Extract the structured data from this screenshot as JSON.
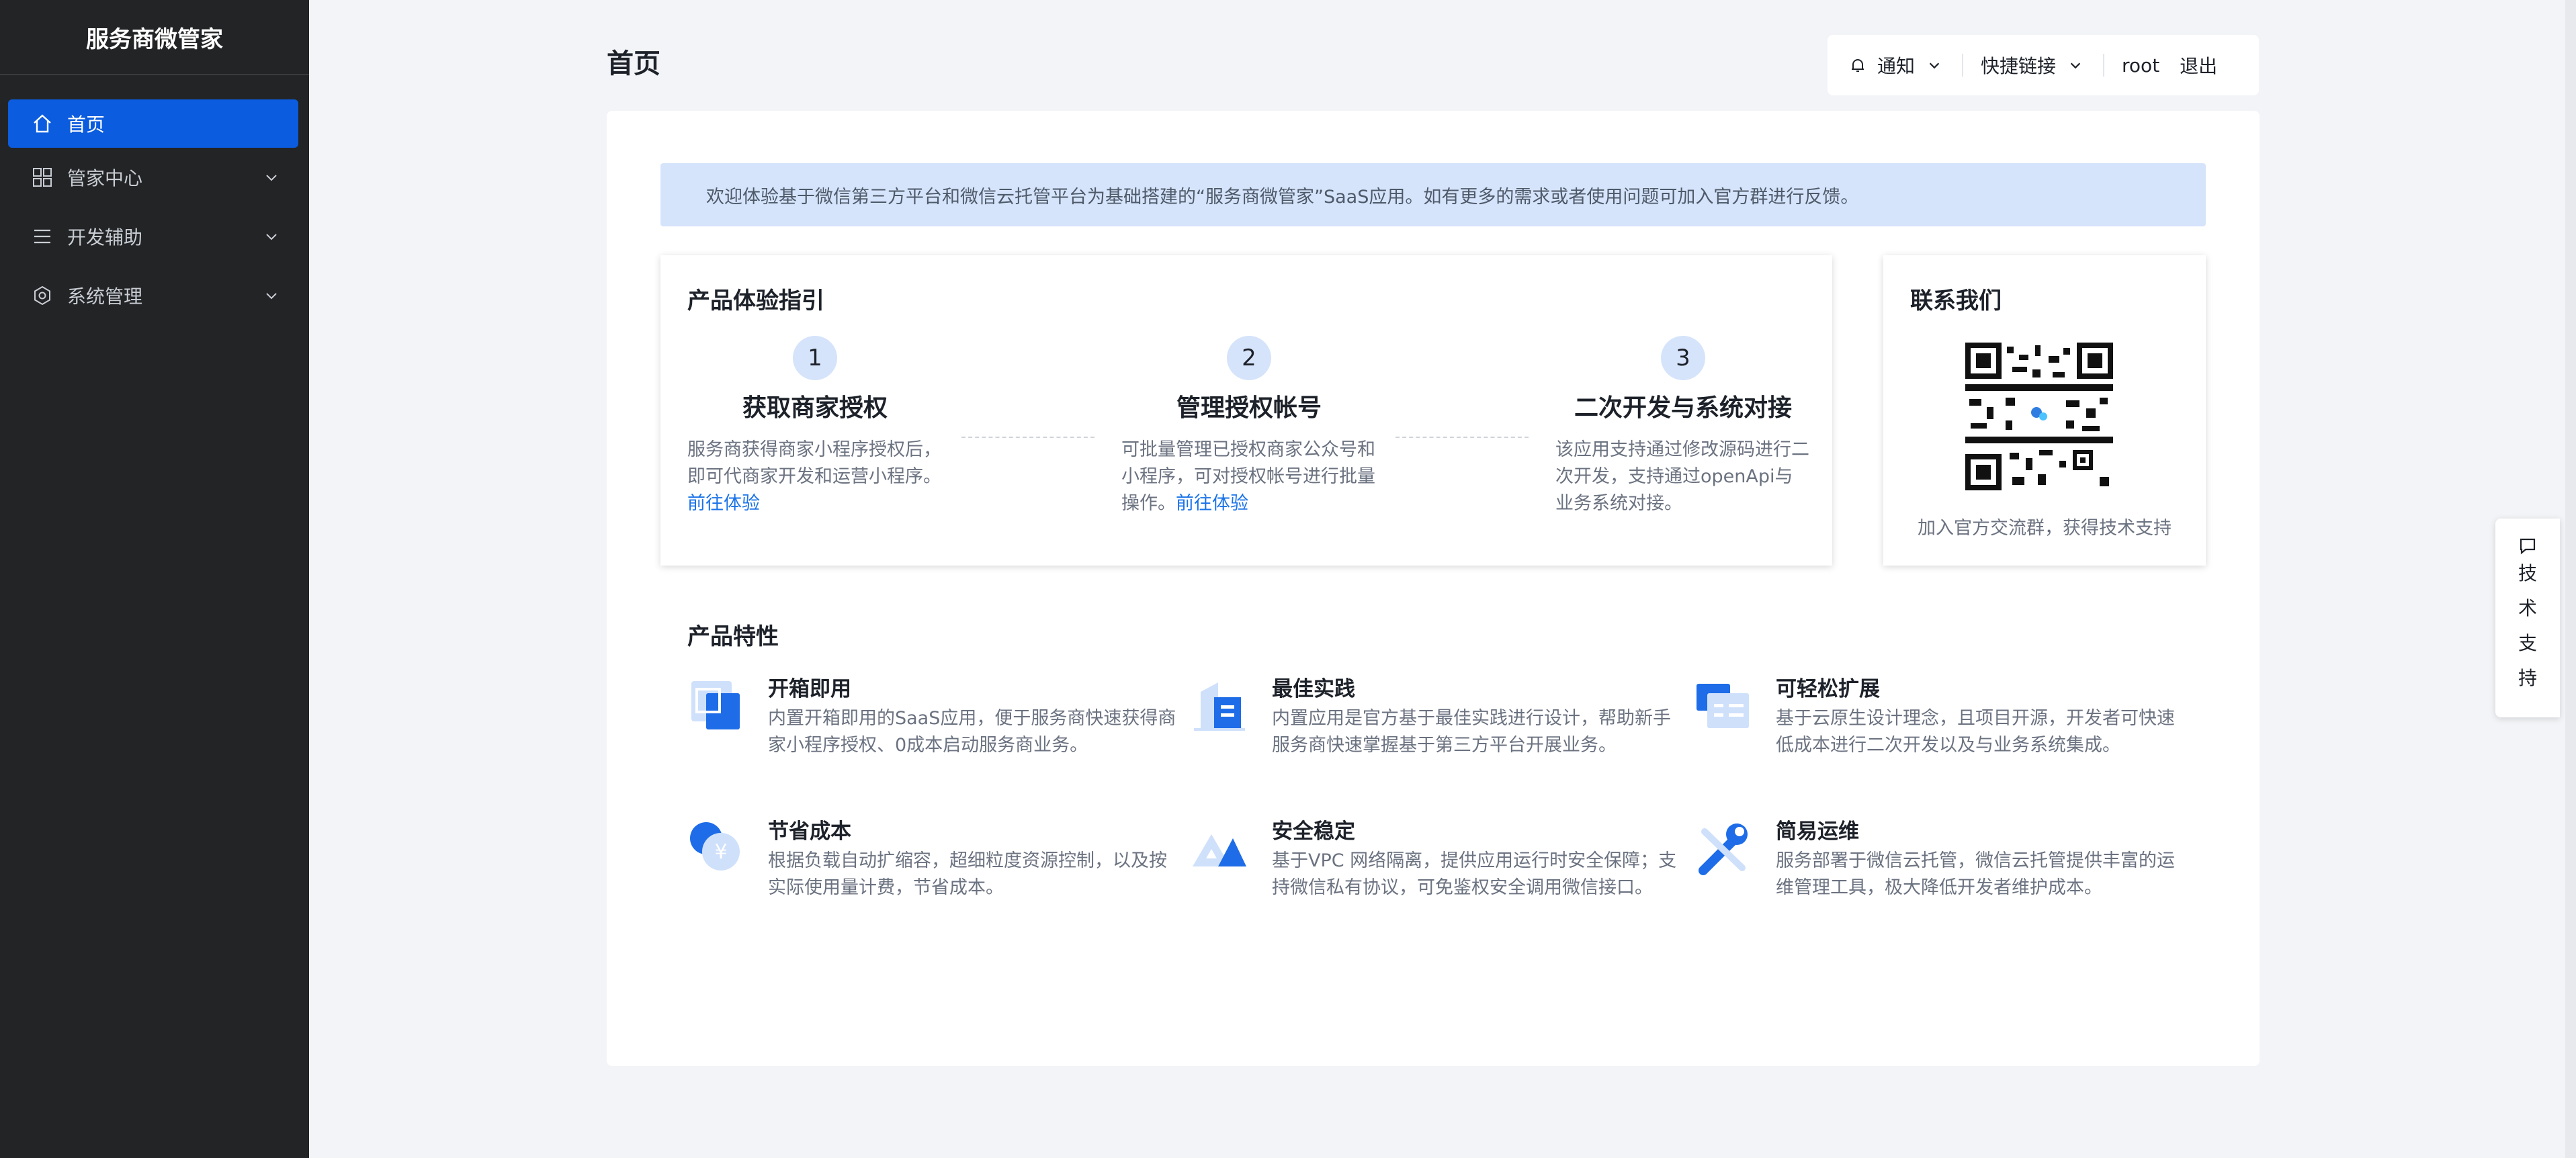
{
  "sidebar": {
    "brand": "服务商微管家",
    "items": [
      {
        "label": "首页",
        "icon": "home-icon",
        "active": true
      },
      {
        "label": "管家中心",
        "icon": "grid-icon",
        "expandable": true
      },
      {
        "label": "开发辅助",
        "icon": "list-icon",
        "expandable": true
      },
      {
        "label": "系统管理",
        "icon": "hexagon-settings-icon",
        "expandable": true
      }
    ]
  },
  "header": {
    "title": "首页",
    "notify_label": "通知",
    "shortcuts_label": "快捷链接",
    "username": "root",
    "logout_label": "退出"
  },
  "banner": {
    "text": "欢迎体验基于微信第三方平台和微信云托管平台为基础搭建的“服务商微管家”SaaS应用。如有更多的需求或者使用问题可加入官方群进行反馈。"
  },
  "guide": {
    "title": "产品体验指引",
    "steps": [
      {
        "num": "1",
        "title": "获取商家授权",
        "desc": "服务商获得商家小程序授权后，即可代商家开发和运营小程序。",
        "link": "前往体验"
      },
      {
        "num": "2",
        "title": "管理授权帐号",
        "desc": "可批量管理已授权商家公众号和小程序，可对授权帐号进行批量操作。",
        "link": "前往体验"
      },
      {
        "num": "3",
        "title": "二次开发与系统对接",
        "desc": "该应用支持通过修改源码进行二次开发，支持通过openApi与业务系统对接。",
        "link": ""
      }
    ]
  },
  "contact": {
    "title": "联系我们",
    "caption": "加入官方交流群，获得技术支持",
    "qr_icon": "qr-code-icon"
  },
  "features": {
    "title": "产品特性",
    "items": [
      {
        "title": "开箱即用",
        "desc": "内置开箱即用的SaaS应用，便于服务商快速获得商家小程序授权、0成本启动服务商业务。",
        "icon": "box-icon"
      },
      {
        "title": "最佳实践",
        "desc": "内置应用是官方基于最佳实践进行设计，帮助新手服务商快速掌握基于第三方平台开展业务。",
        "icon": "building-icon"
      },
      {
        "title": "可轻松扩展",
        "desc": "基于云原生设计理念，且项目开源，开发者可快速低成本进行二次开发以及与业务系统集成。",
        "icon": "window-list-icon"
      },
      {
        "title": "节省成本",
        "desc": "根据负载自动扩缩容，超细粒度资源控制，以及按实际使用量计费，节省成本。",
        "icon": "yen-coin-icon"
      },
      {
        "title": "安全稳定",
        "desc": "基于VPC 网络隔离，提供应用运行时安全保障；支持微信私有协议，可免鉴权安全调用微信接口。",
        "icon": "mountain-shield-icon"
      },
      {
        "title": "简易运维",
        "desc": "服务部署于微信云托管，微信云托管提供丰富的运维管理工具，极大降低开发者维护成本。",
        "icon": "wrench-icon"
      }
    ]
  },
  "support": {
    "chars": [
      "技",
      "术",
      "支",
      "持"
    ],
    "icon": "chat-icon"
  },
  "colors": {
    "sidebar_bg": "#232426",
    "active_blue": "#0b5cde",
    "banner_bg": "#d5e4fb",
    "link_blue": "#1a73e8"
  }
}
